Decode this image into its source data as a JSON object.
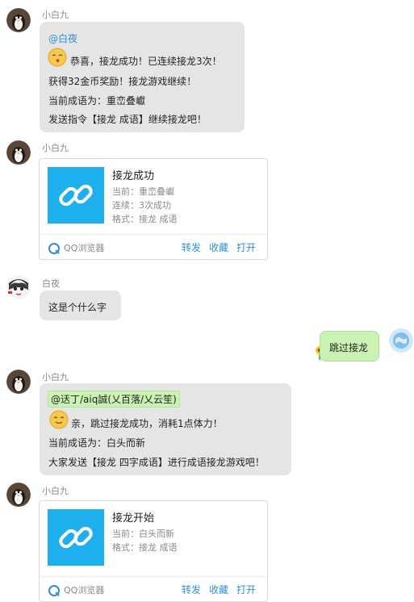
{
  "messages": [
    {
      "sender": "小白九",
      "mention": "@白夜",
      "lines": [
        "恭喜，接龙成功！已连续接龙3次！",
        "获得32金币奖励！接龙游戏继续！",
        "当前成语为：重峦叠巘",
        "发送指令【接龙 成语】继续接龙吧！"
      ]
    },
    {
      "sender": "小白九",
      "card": {
        "title": "接龙成功",
        "lines": [
          "当前：重峦叠巘",
          "连续：3次成功",
          "格式：接龙 成语"
        ],
        "source": "QQ浏览器",
        "actions": [
          "转发",
          "收藏",
          "打开"
        ]
      }
    },
    {
      "sender": "白夜",
      "text": "这是个什么字"
    },
    {
      "self": true,
      "text": "跳过接龙"
    },
    {
      "sender": "小白九",
      "mention": "@迗丁/aiq誠(乂百落/乂云笙)",
      "lines": [
        "亲，跳过接龙成功，消耗1点体力！",
        "当前成语为：白头而新",
        "大家发送【接龙 四字成语】进行成语接龙游戏吧！"
      ]
    },
    {
      "sender": "小白九",
      "card": {
        "title": "接龙开始",
        "lines": [
          "当前：白头而新",
          "格式：接龙 成语"
        ],
        "source": "QQ浏览器",
        "actions": [
          "转发",
          "收藏",
          "打开"
        ]
      }
    }
  ],
  "colors": {
    "bubble": "#e5e5e5",
    "self_bubble": "#c9f2b3",
    "mention": "#2f8fd6",
    "link_card_thumb": "#1eb0ee",
    "action": "#2f8fd6"
  },
  "icons": [
    "penguin-avatar",
    "anime-avatar",
    "globe-avatar",
    "kiss-emoji",
    "smile-emoji",
    "link-icon",
    "qq-browser-icon",
    "sunflower-icon"
  ]
}
